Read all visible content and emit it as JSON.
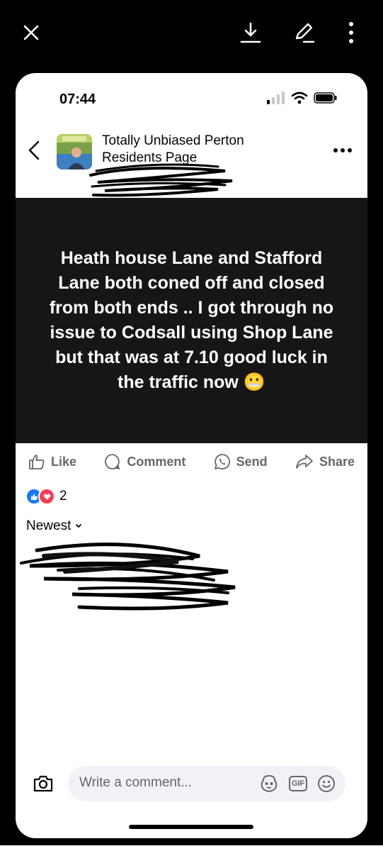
{
  "viewer": {
    "icons": [
      "close-icon",
      "download-icon",
      "edit-icon",
      "more-vertical-icon"
    ]
  },
  "status_bar": {
    "time": "07:44"
  },
  "header": {
    "group_name": "Totally Unbiased Perton Residents Page"
  },
  "post": {
    "text": "Heath house Lane and Stafford Lane both coned off and closed from both ends .. I got through no issue to Codsall using Shop Lane but that was at 7.10 good luck in the traffic now 😬"
  },
  "actions": {
    "like": "Like",
    "comment": "Comment",
    "send": "Send",
    "share": "Share"
  },
  "reactions": {
    "count": "2"
  },
  "comments": {
    "sort_label": "Newest"
  },
  "composer": {
    "placeholder": "Write a comment...",
    "gif_label": "GIF"
  },
  "colors": {
    "accent": "#1877f2",
    "love": "#f33e58",
    "post_background": "#161616"
  }
}
